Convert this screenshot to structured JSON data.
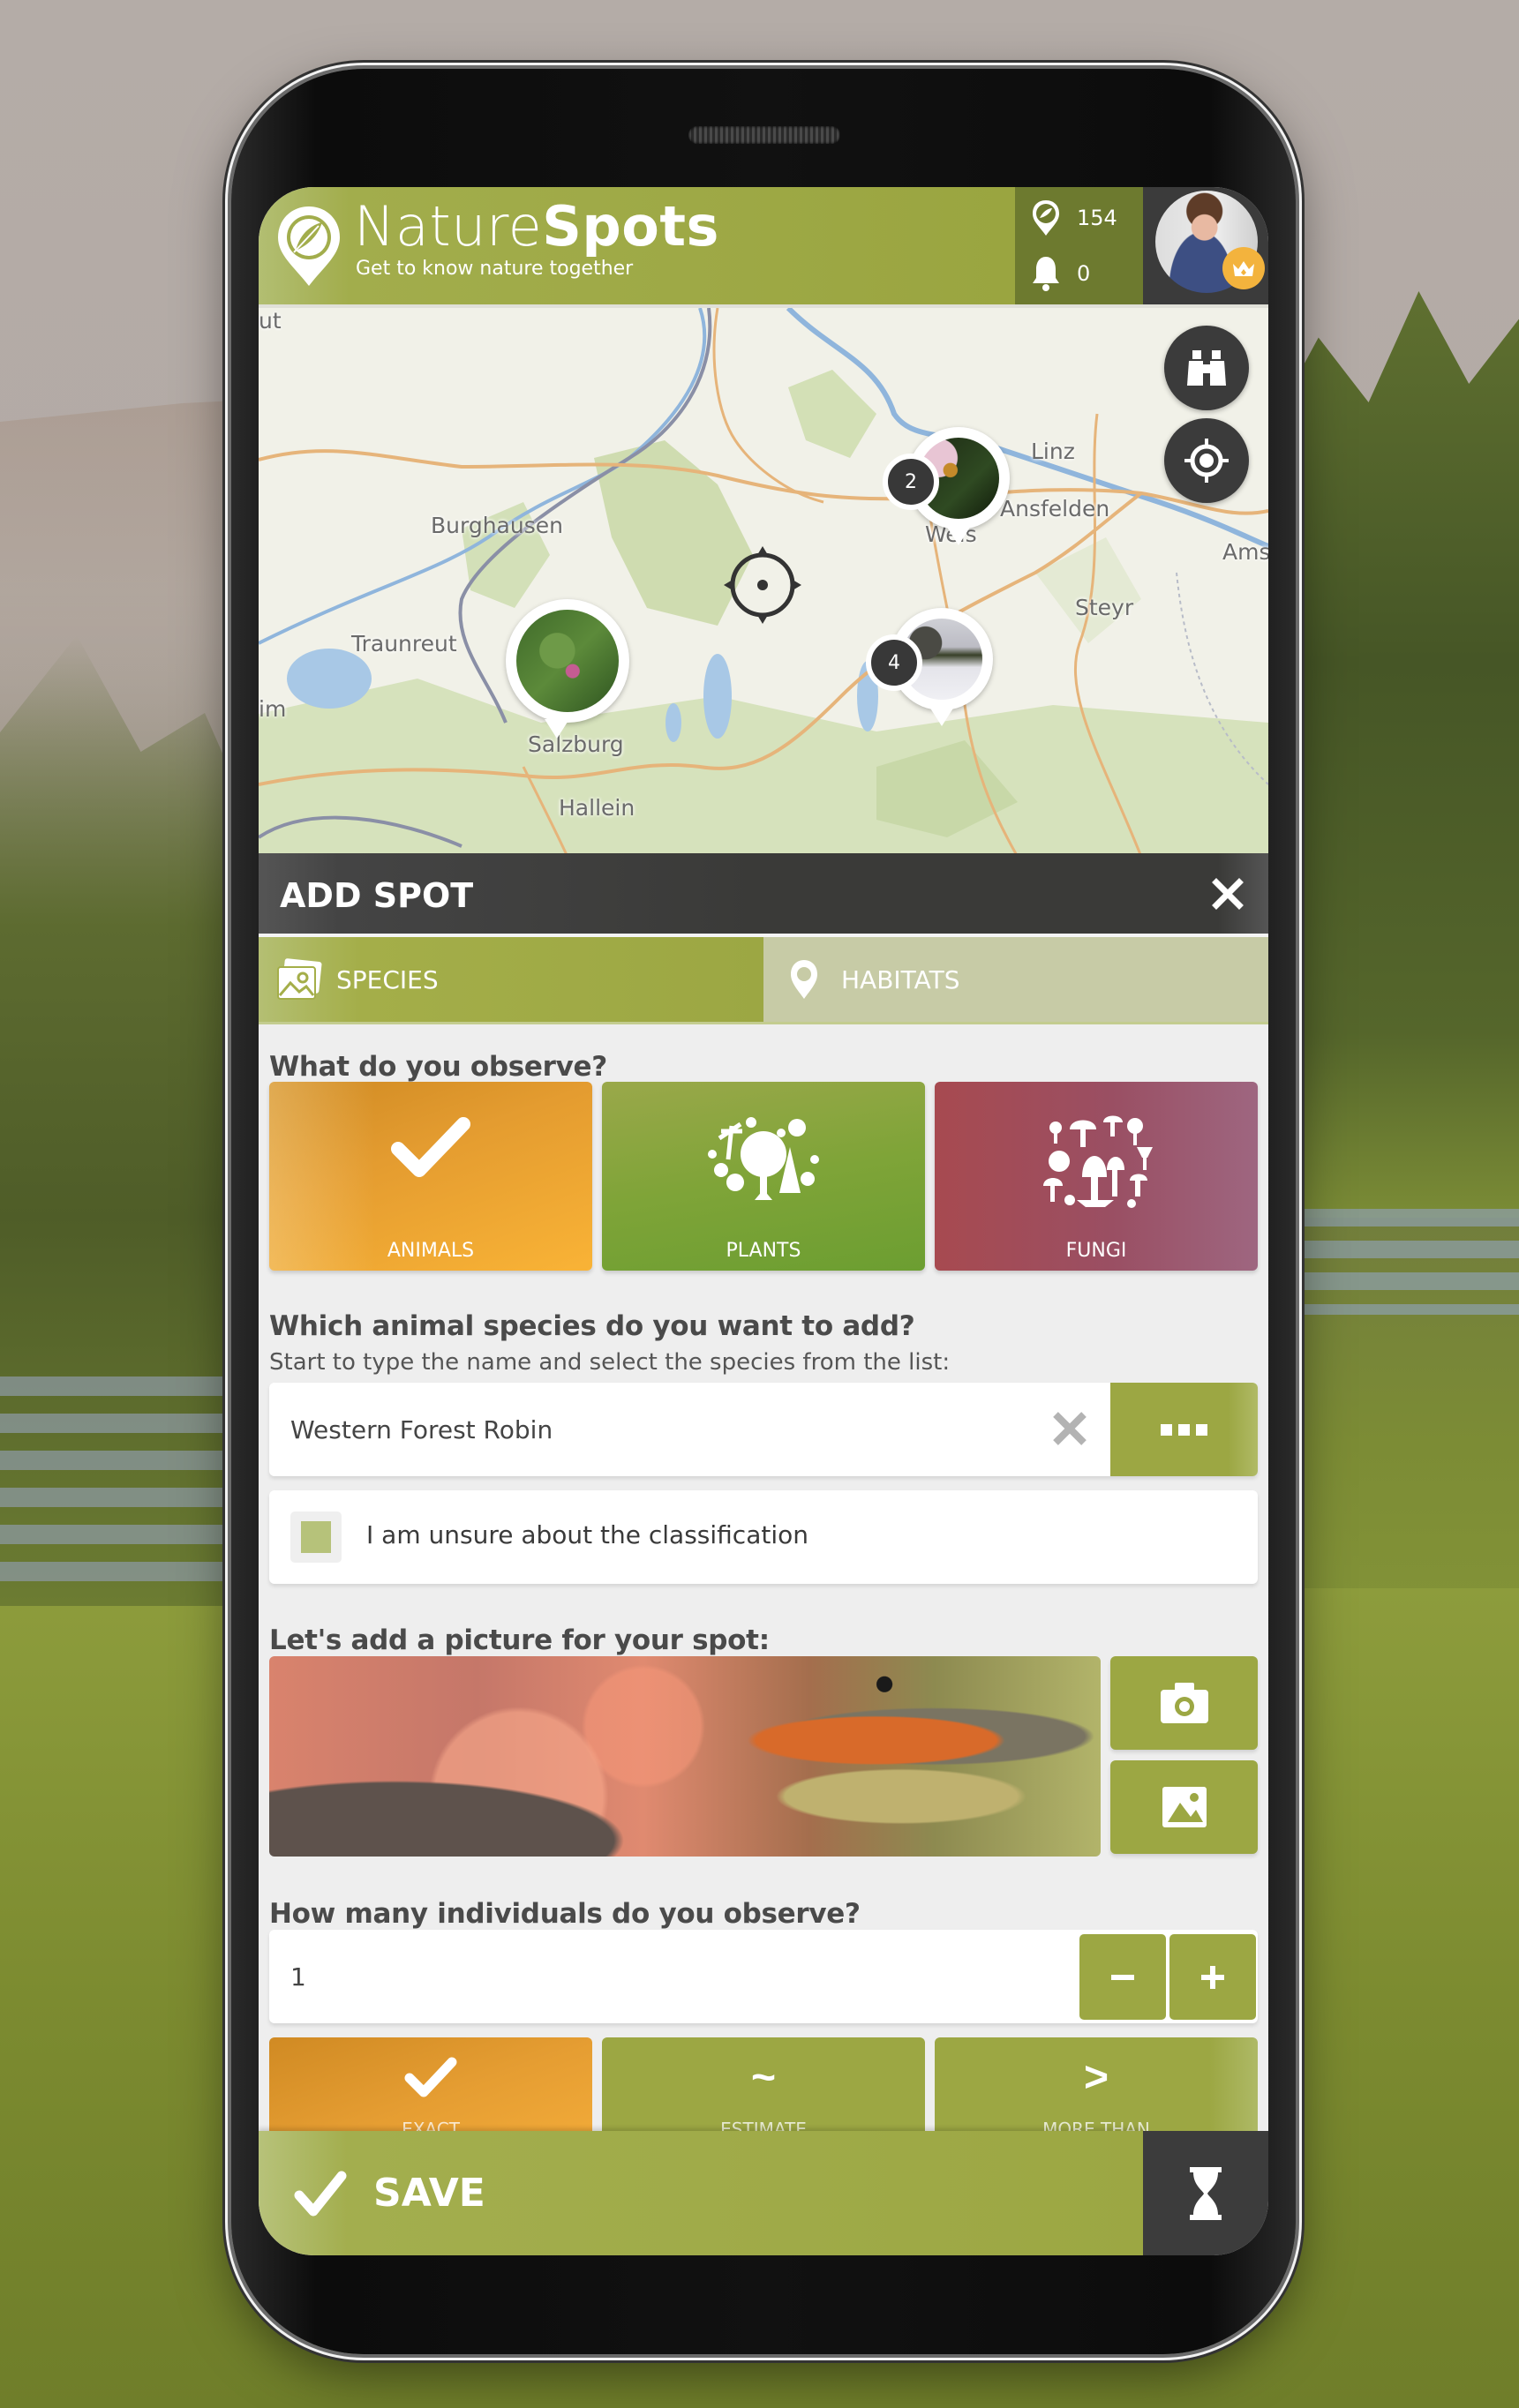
{
  "app": {
    "name_light": "Nature",
    "name_bold": "Spots",
    "tagline": "Get to know nature together"
  },
  "header": {
    "spots_count": "154",
    "notifications_count": "0",
    "avatar_badge": "crown-icon"
  },
  "map": {
    "labels": [
      "ut",
      "Burghausen",
      "Traunreut",
      "Salzburg",
      "Hallein",
      "Linz",
      "Ansfelden",
      "Weis",
      "Steyr",
      "Ams",
      "im"
    ],
    "clusters": [
      {
        "count": "",
        "photo": "plant-photo"
      },
      {
        "count": "2",
        "photo": "bee-flower-photo"
      },
      {
        "count": "4",
        "photo": "snow-birds-photo"
      }
    ],
    "buttons": {
      "explore": "binoculars-icon",
      "locate": "crosshair-icon"
    }
  },
  "panel": {
    "title": "ADD SPOT",
    "tabs": [
      {
        "label": "SPECIES",
        "icon": "images-icon",
        "active": true
      },
      {
        "label": "HABITATS",
        "icon": "location-pin-icon",
        "active": false
      }
    ]
  },
  "form": {
    "observe_heading": "What do you observe?",
    "categories": [
      {
        "label": "ANIMALS",
        "selected": true,
        "color": "#e9a030"
      },
      {
        "label": "PLANTS",
        "selected": false,
        "color": "#82a33a"
      },
      {
        "label": "FUNGI",
        "selected": false,
        "color": "#9d4f5f"
      }
    ],
    "species_heading": "Which animal species do you want to add?",
    "species_sub": "Start to type the name and select the species from the list:",
    "species_value": "Western Forest Robin",
    "unsure_label": "I am unsure about the classification",
    "unsure_checked": false,
    "picture_heading": "Let's add a picture for your spot:",
    "count_heading": "How many individuals do you observe?",
    "count_value": "1",
    "count_types": [
      {
        "label": "EXACT",
        "symbol": "✔",
        "selected": true
      },
      {
        "label": "ESTIMATE",
        "symbol": "~",
        "selected": false
      },
      {
        "label": "MORE THAN",
        "symbol": ">",
        "selected": false
      }
    ]
  },
  "footer": {
    "save_label": "SAVE"
  },
  "colors": {
    "brand_green": "#9ca743",
    "dark_green": "#6d7a2f",
    "dark_gray": "#3b3b3b",
    "accent_orange": "#e9a030",
    "fungi_red": "#9d4f5f",
    "crown_yellow": "#f3b33d"
  }
}
